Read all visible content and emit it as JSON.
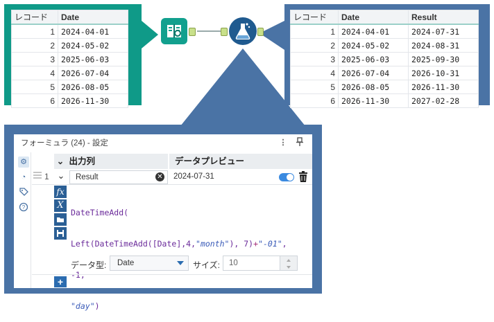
{
  "input_table": {
    "headers": [
      "レコード",
      "Date"
    ],
    "rows": [
      [
        "1",
        "2024-04-01"
      ],
      [
        "2",
        "2024-05-02"
      ],
      [
        "3",
        "2025-06-03"
      ],
      [
        "4",
        "2026-07-04"
      ],
      [
        "5",
        "2026-08-05"
      ],
      [
        "6",
        "2026-11-30"
      ]
    ]
  },
  "output_table": {
    "headers": [
      "レコード",
      "Date",
      "Result"
    ],
    "rows": [
      [
        "1",
        "2024-04-01",
        "2024-07-31"
      ],
      [
        "2",
        "2024-05-02",
        "2024-08-31"
      ],
      [
        "3",
        "2025-06-03",
        "2025-09-30"
      ],
      [
        "4",
        "2026-07-04",
        "2026-10-31"
      ],
      [
        "5",
        "2026-08-05",
        "2026-11-30"
      ],
      [
        "6",
        "2026-11-30",
        "2027-02-28"
      ]
    ]
  },
  "workflow": {
    "input_tool_icon": "browse-book-icon",
    "formula_tool_icon": "formula-flask-icon",
    "colors": {
      "teal": "#0f9a88",
      "blue": "#4a73a5",
      "tool_blue": "#1f5a8f"
    }
  },
  "panel": {
    "title": "フォーミュラ (24) - 設定",
    "header_output_column": "出力列",
    "header_data_preview": "データプレビュー",
    "row_number": "1",
    "output_field_value": "Result",
    "preview_value": "2024-07-31",
    "expression_lines": [
      "DateTimeAdd(",
      "Left(DateTimeAdd([Date],4,\"month\"), 7)+\"-01\",",
      "-1,",
      "\"day\""
    ],
    "expression_line1": "DateTimeAdd(",
    "expression_line2_a": "Left(DateTimeAdd([Date],4,",
    "expression_line2_b": "\"month\"",
    "expression_line2_c": "), 7)",
    "expression_line2_d": "+",
    "expression_line2_e": "\"-01\"",
    "expression_line2_f": ",",
    "expression_line3": "-1,",
    "expression_line4": "\"day\"",
    "expression_line4_close": ")",
    "data_type_label": "データ型:",
    "data_type_value": "Date",
    "size_label": "サイズ:",
    "size_value": "10",
    "fx_label": "fx",
    "x_label": "X"
  }
}
